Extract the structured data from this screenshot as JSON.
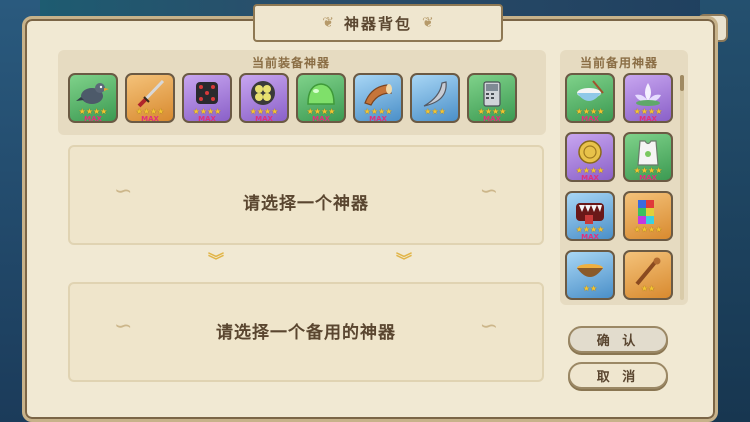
{
  "window": {
    "title": "神器背包"
  },
  "equipped": {
    "label": "当前装备神器",
    "items": [
      {
        "icon": "pigeon-icon",
        "quality": "green",
        "stars": "★★★★",
        "max": "MAX"
      },
      {
        "icon": "katana-icon",
        "quality": "orange",
        "stars": "★★★★",
        "max": "MAX"
      },
      {
        "icon": "dice-icon",
        "quality": "purple",
        "stars": "★★★★",
        "max": "MAX"
      },
      {
        "icon": "clover-tin-icon",
        "quality": "purple",
        "stars": "★★★★",
        "max": "MAX"
      },
      {
        "icon": "slime-icon",
        "quality": "green",
        "stars": "★★★★",
        "max": "MAX"
      },
      {
        "icon": "horn-icon",
        "quality": "blue",
        "stars": "★★★★",
        "max": "MAX"
      },
      {
        "icon": "claw-blade-icon",
        "quality": "blue",
        "stars": "★★★",
        "max": ""
      },
      {
        "icon": "phone-icon",
        "quality": "green",
        "stars": "★★★★",
        "max": "MAX"
      }
    ]
  },
  "slots": {
    "select_artifact": "请选择一个神器",
    "select_spare": "请选择一个备用的神器"
  },
  "spare": {
    "label": "当前备用神器",
    "items": [
      {
        "icon": "rice-bowl-icon",
        "quality": "green",
        "stars": "★★★★",
        "max": "MAX"
      },
      {
        "icon": "lotus-icon",
        "quality": "purple",
        "stars": "★★★★",
        "max": "MAX"
      },
      {
        "icon": "gold-coin-icon",
        "quality": "purple",
        "stars": "★★★★",
        "max": "MAX"
      },
      {
        "icon": "vest-icon",
        "quality": "green",
        "stars": "★★★★",
        "max": "MAX"
      },
      {
        "icon": "monster-mouth-icon",
        "quality": "blue",
        "stars": "★★★★",
        "max": "MAX"
      },
      {
        "icon": "pixel-cube-icon",
        "quality": "orange",
        "stars": "★★★★",
        "max": ""
      },
      {
        "icon": "soup-bowl-icon",
        "quality": "blue",
        "stars": "★★",
        "max": ""
      },
      {
        "icon": "wooden-staff-icon",
        "quality": "orange",
        "stars": "★★",
        "max": ""
      }
    ]
  },
  "buttons": {
    "confirm": "确 认",
    "cancel": "取 消"
  }
}
